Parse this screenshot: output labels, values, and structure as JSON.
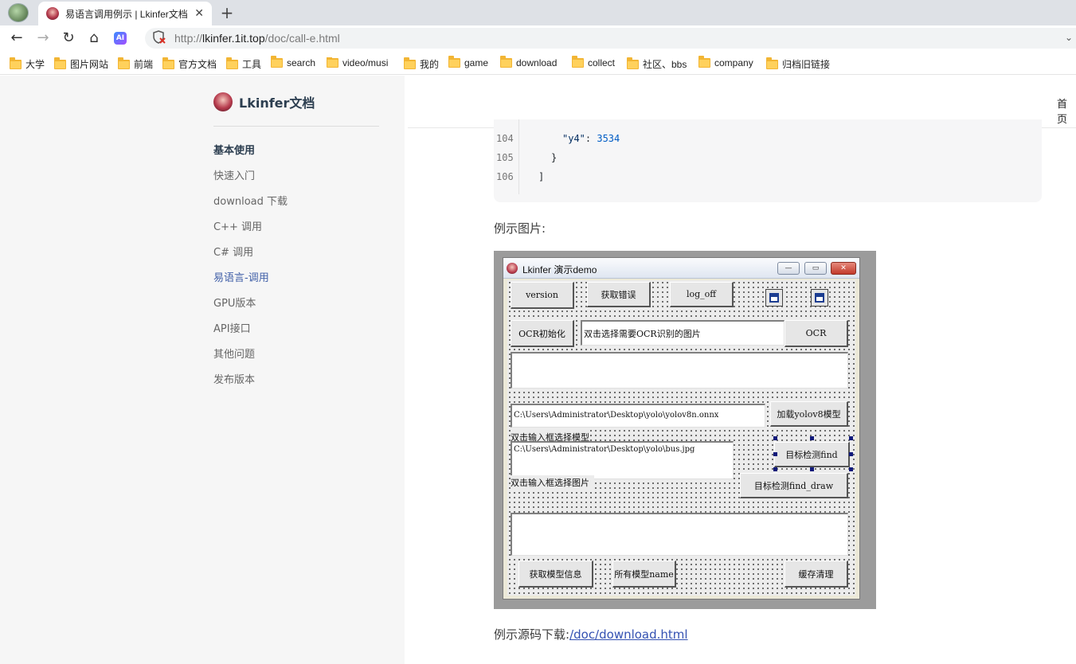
{
  "browser": {
    "tab_title": "易语言调用例示 | Lkinfer文档",
    "tab_close": "✕",
    "new_tab": "+",
    "nav": {
      "back": "←",
      "forward": "→",
      "reload": "↻",
      "home": "⌂",
      "ai": "AI"
    },
    "url_scheme": "http://",
    "url_host": "lkinfer.1it.top",
    "url_path": "/doc/call-e.html",
    "bookmarks": [
      "大学",
      "图片网站",
      "前端",
      "官方文档",
      "工具",
      "search",
      "video/musi",
      "我的",
      "game",
      "download",
      "collect",
      "社区、bbs",
      "company",
      "归档旧链接"
    ]
  },
  "site": {
    "brand": "Lkinfer文档",
    "top_nav_home": "首页",
    "sidebar": {
      "heading": "基本使用",
      "items": [
        {
          "label": "快速入门"
        },
        {
          "label": "download 下载"
        },
        {
          "label": "C++ 调用"
        },
        {
          "label": "C# 调用"
        },
        {
          "label": "易语言-调用",
          "active": true
        },
        {
          "label": "GPU版本"
        },
        {
          "label": "API接口"
        },
        {
          "label": "其他问题"
        },
        {
          "label": "发布版本"
        }
      ]
    }
  },
  "code": {
    "lines": [
      {
        "no": "104",
        "key": "\"y4\"",
        "sep": ": ",
        "value": "3534"
      },
      {
        "no": "105",
        "text": "}"
      },
      {
        "no": "106",
        "text": "]"
      }
    ]
  },
  "content": {
    "example_image_label": "例示图片:",
    "source_label": "例示源码下载:",
    "source_link": "/doc/download.html"
  },
  "demo_app": {
    "title": "Lkinfer 演示demo",
    "title_buttons": {
      "min": "—",
      "max": "▭",
      "close": "✕"
    },
    "buttons": {
      "version": "version",
      "get_error": "获取错误",
      "log_off": "log_off",
      "ocr_init": "OCR初始化",
      "ocr": "OCR",
      "load_yolo": "加载yolov8模型",
      "find": "目标检测find",
      "find_draw": "目标检测find_draw",
      "model_info": "获取模型信息",
      "all_models": "所有模型name",
      "clear_cache": "缓存清理"
    },
    "inputs": {
      "ocr_image": "双击选择需要OCR识别的图片",
      "model_path": "C:\\Users\\Administrator\\Desktop\\yolo\\yolov8n.onnx",
      "image_path": "C:\\Users\\Administrator\\Desktop\\yolo\\bus.jpg"
    },
    "labels": {
      "select_model": "双击输入框选择模型",
      "select_image": "双击输入框选择图片"
    }
  }
}
